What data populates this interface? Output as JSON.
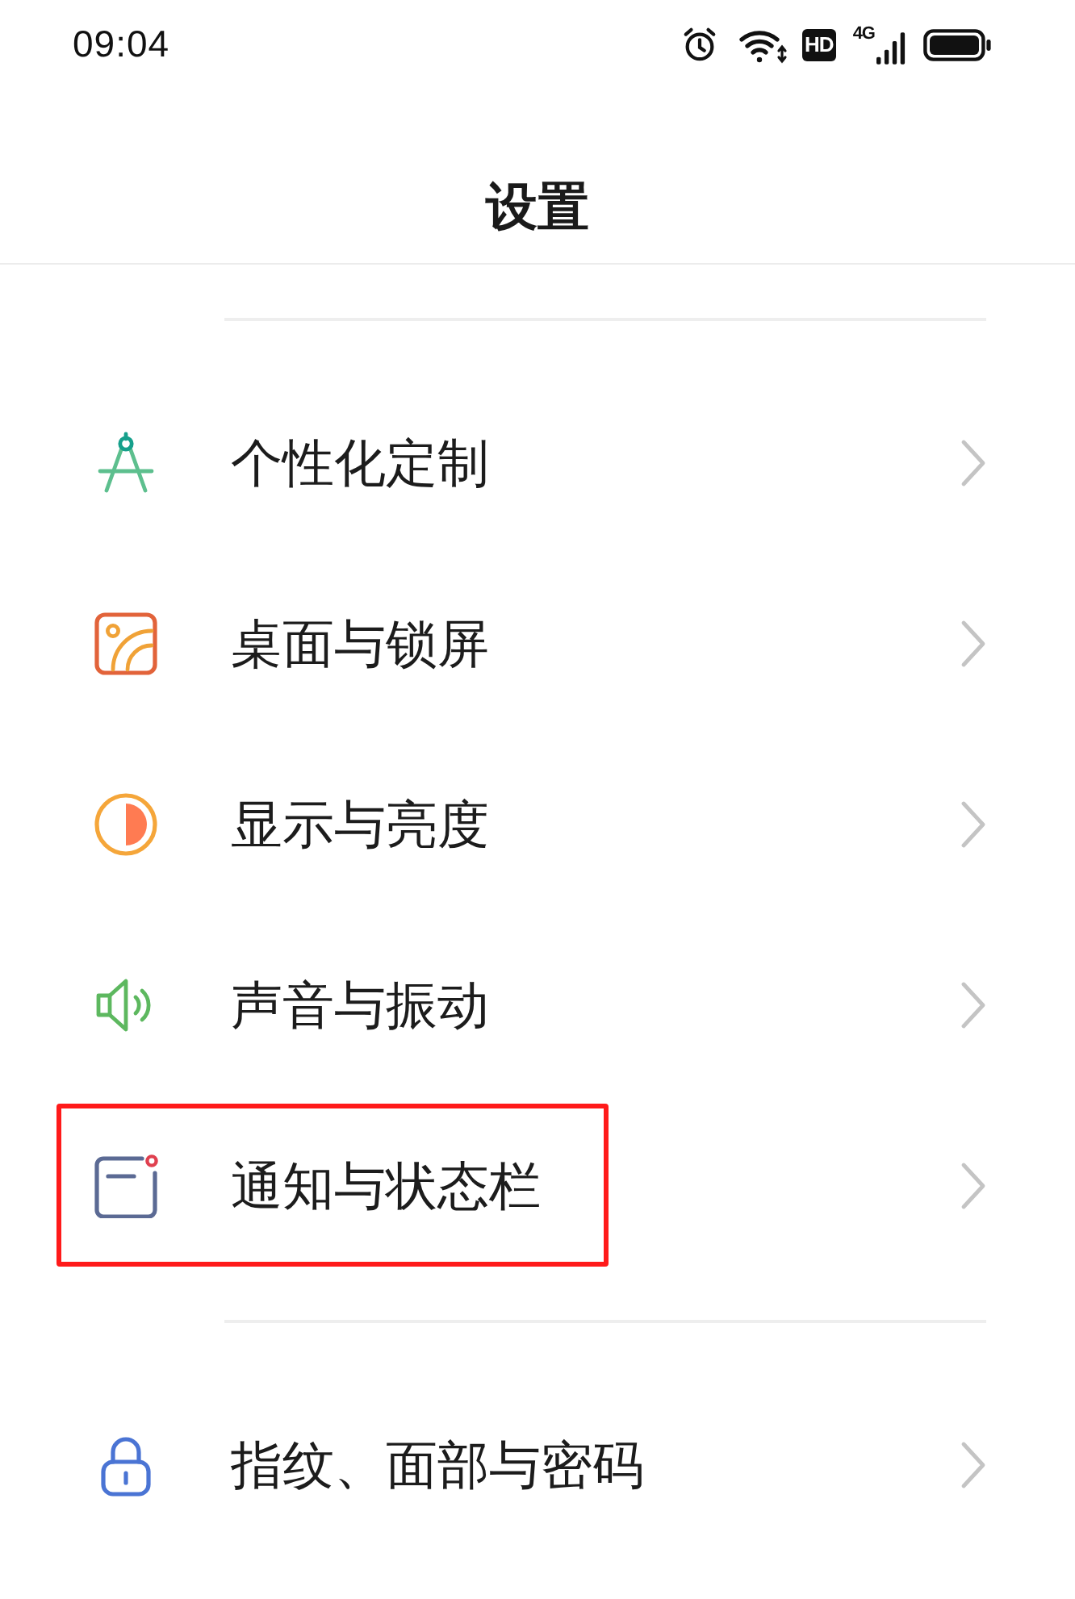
{
  "status_bar": {
    "time": "09:04",
    "hd_badge": "HD",
    "network_type": "4G"
  },
  "header": {
    "title": "设置"
  },
  "groups": [
    {
      "items": [
        {
          "label": "个性化定制",
          "highlighted": false
        },
        {
          "label": "桌面与锁屏",
          "highlighted": false
        },
        {
          "label": "显示与亮度",
          "highlighted": false
        },
        {
          "label": "声音与振动",
          "highlighted": false
        },
        {
          "label": "通知与状态栏",
          "highlighted": true
        }
      ]
    },
    {
      "items": [
        {
          "label": "指纹、面部与密码",
          "highlighted": false
        }
      ]
    }
  ]
}
